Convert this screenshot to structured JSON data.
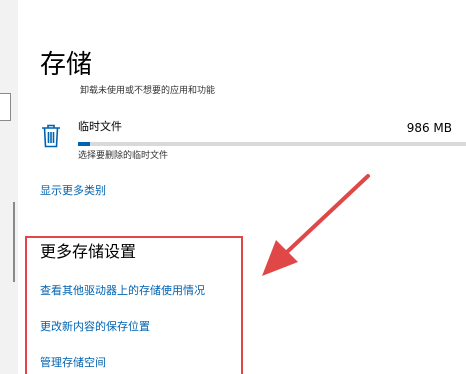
{
  "page": {
    "title": "存储",
    "subtitle": "卸载未使用或不想要的应用和功能"
  },
  "storage_item": {
    "icon": "trash-icon",
    "name": "临时文件",
    "size": "986 MB",
    "usage_fraction": 0.03,
    "description": "选择要删除的临时文件"
  },
  "show_more_link": "显示更多类别",
  "more_settings": {
    "heading": "更多存储设置",
    "links": [
      "查看其他驱动器上的存储使用情况",
      "更改新内容的保存位置",
      "管理存储空间"
    ]
  },
  "colors": {
    "accent": "#0063b1",
    "annotation": "#e04848",
    "progress_track": "#d9d9d9"
  }
}
